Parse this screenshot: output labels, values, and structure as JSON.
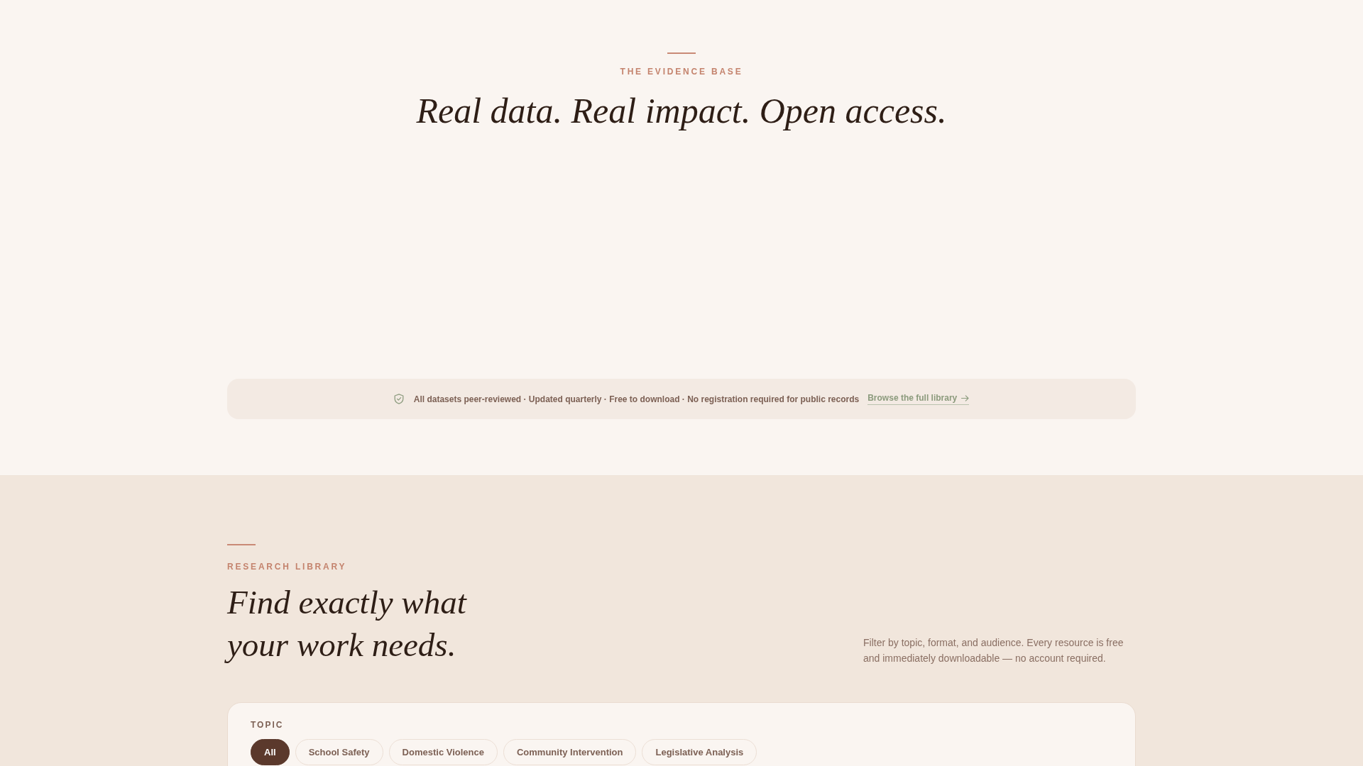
{
  "evidence": {
    "eyebrow": "THE EVIDENCE BASE",
    "headline": "Real data. Real impact. Open access.",
    "notice": {
      "text": "All datasets peer-reviewed · Updated quarterly · Free to download · No registration required for public records",
      "link": "Browse the full library"
    }
  },
  "library": {
    "eyebrow": "RESEARCH LIBRARY",
    "headline": "Find exactly what your work needs.",
    "description": "Filter by topic, format, and audience. Every resource is free and immediately downloadable — no account required.",
    "filters": {
      "label": "TOPIC",
      "chips": [
        {
          "label": "All",
          "selected": true
        },
        {
          "label": "School Safety",
          "selected": false
        },
        {
          "label": "Domestic Violence",
          "selected": false
        },
        {
          "label": "Community Intervention",
          "selected": false
        },
        {
          "label": "Legislative Analysis",
          "selected": false
        }
      ]
    }
  }
}
